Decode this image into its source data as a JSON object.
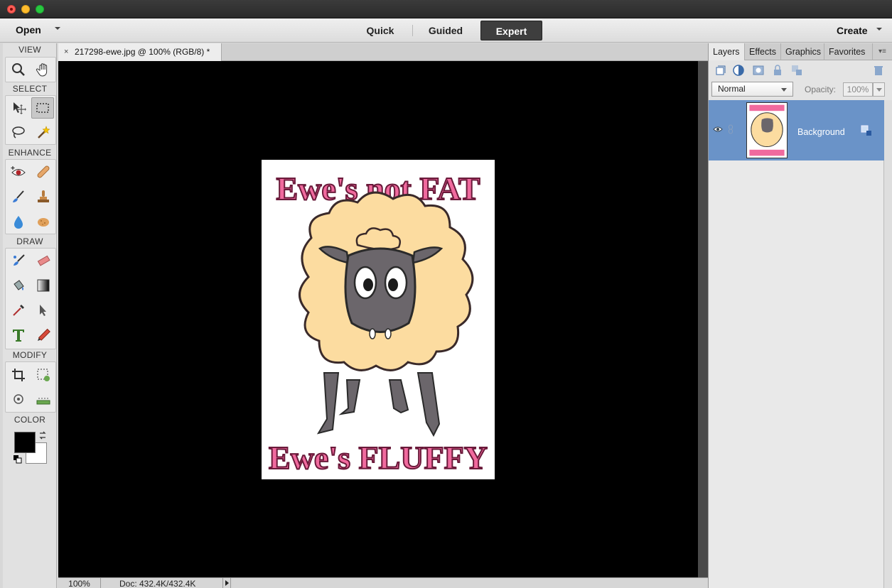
{
  "window": {
    "controls": [
      "close",
      "minimize",
      "maximize"
    ]
  },
  "topbar": {
    "open_label": "Open",
    "modes": [
      "Quick",
      "Guided",
      "Expert"
    ],
    "active_mode": "Expert",
    "create_label": "Create"
  },
  "toolbox": {
    "sections": {
      "view": "VIEW",
      "select": "SELECT",
      "enhance": "ENHANCE",
      "draw": "DRAW",
      "modify": "MODIFY",
      "color": "COLOR"
    },
    "tools": {
      "view": [
        "zoom-tool-icon",
        "hand-tool-icon"
      ],
      "select": [
        "move-tool-icon",
        "marquee-tool-icon",
        "lasso-tool-icon",
        "magic-wand-icon"
      ],
      "enhance": [
        "red-eye-icon",
        "spot-healing-icon",
        "smart-brush-icon",
        "clone-stamp-icon",
        "blur-icon",
        "sponge-icon"
      ],
      "draw": [
        "brush-icon",
        "eraser-icon",
        "paint-bucket-icon",
        "gradient-icon",
        "eyedropper-icon",
        "custom-shape-icon",
        "type-tool-icon",
        "pencil-icon"
      ],
      "modify": [
        "crop-icon",
        "recompose-icon",
        "content-aware-move-icon",
        "straighten-icon"
      ]
    },
    "selected_tool": "marquee-tool-icon",
    "foreground_color": "#000000",
    "background_color": "#ffffff"
  },
  "document": {
    "tab_title": "217298-ewe.jpg @ 100% (RGB/8) *",
    "close_glyph": "×",
    "image_text_top": "Ewe's not FAT",
    "image_text_bottom": "Ewe's FLUFFY"
  },
  "status": {
    "zoom": "100%",
    "doc_size": "Doc: 432.4K/432.4K"
  },
  "panel": {
    "tabs": [
      "Layers",
      "Effects",
      "Graphics",
      "Favorites"
    ],
    "active_tab": "Layers",
    "blend_mode": "Normal",
    "opacity_label": "Opacity:",
    "opacity_value": "100%",
    "layers": [
      {
        "name": "Background",
        "visible": true,
        "selected": true
      }
    ]
  },
  "colors": {
    "accent_layer_selected": "#6a93c8",
    "image_text_pink": "#f06a9e",
    "wool": "#fcdca0",
    "sheep_face": "#6b666b"
  }
}
